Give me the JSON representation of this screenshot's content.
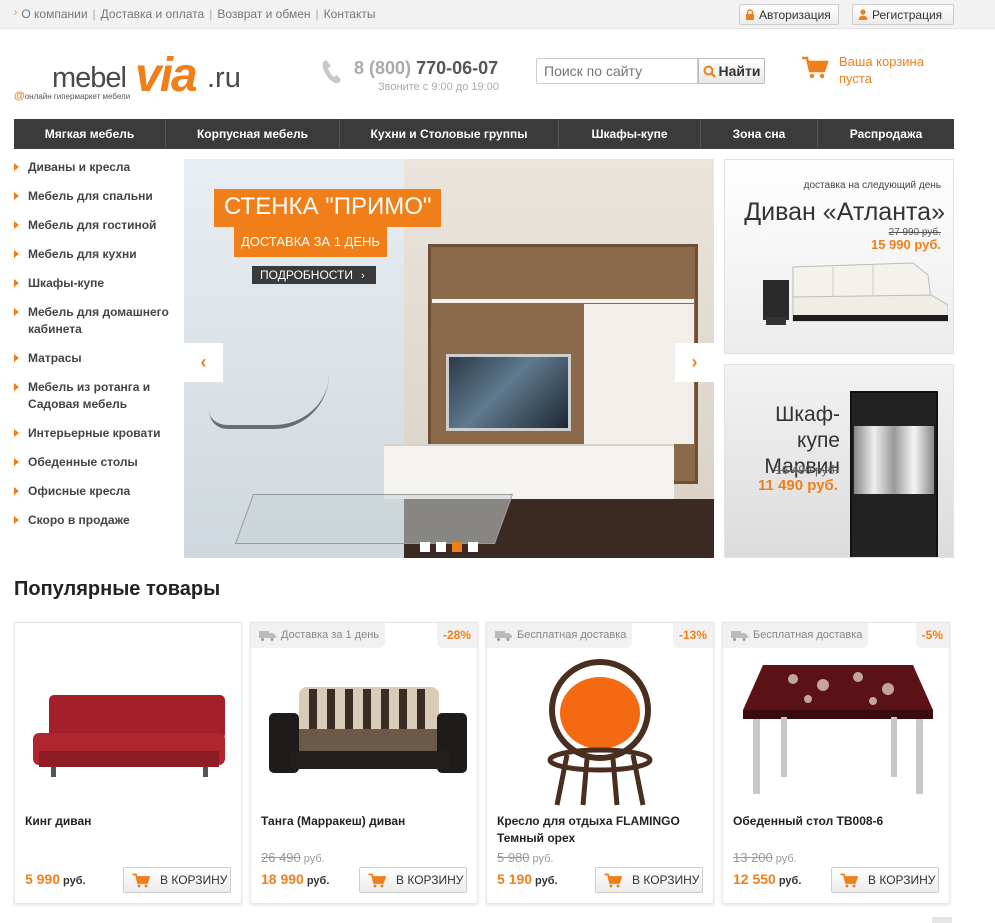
{
  "topbar": {
    "links": [
      "О компании",
      "Доставка и оплата",
      "Возврат и обмен",
      "Контакты"
    ],
    "auth_label": "Авторизация",
    "register_label": "Регистрация"
  },
  "logo": {
    "mebel": "mebel",
    "via": "via",
    "ru": ".ru",
    "tagline": "онлайн гипермаркет мебели"
  },
  "contact": {
    "phone_prefix": "8 (800)",
    "phone_number": "770-06-07",
    "hours": "Звоните с 9:00 до 19:00"
  },
  "search": {
    "placeholder": "Поиск по сайту",
    "button": "Найти"
  },
  "cart": {
    "text": "Ваша корзина пуста"
  },
  "nav": [
    "Мягкая мебель",
    "Корпусная мебель",
    "Кухни и Столовые группы",
    "Шкафы-купе",
    "Зона сна",
    "Распродажа"
  ],
  "sidebar": [
    "Диваны и кресла",
    "Мебель для спальни",
    "Мебель для гостиной",
    "Мебель для кухни",
    "Шкафы-купе",
    "Мебель для домашнего кабинета",
    "Матрасы",
    "Мебель из ротанга и Садовая мебель",
    "Интерьерные кровати",
    "Обеденные столы",
    "Офисные кресла",
    "Скоро в продаже"
  ],
  "slider": {
    "title": "СТЕНКА \"ПРИМО\"",
    "subtitle": "ДОСТАВКА ЗА 1 ДЕНЬ",
    "more": "ПОДРОБНОСТИ",
    "prev_icon": "chevron-left-icon",
    "next_icon": "chevron-right-icon",
    "slide_count": 4,
    "active_slide": 3
  },
  "promo1": {
    "note": "доставка на следующий день",
    "title": "Диван «Атланта»",
    "old_price": "27 990 руб.",
    "new_price": "15 990 руб."
  },
  "promo2": {
    "title": "Шкаф-купе Марвин",
    "old_price": "16 490 руб.",
    "new_price": "11 490 руб."
  },
  "popular": {
    "title": "Популярные товары",
    "currency": "руб.",
    "buy_label": "В КОРЗИНУ",
    "items": [
      {
        "ship": "",
        "discount": "",
        "name": "Кинг диван",
        "old_price": "",
        "price": "5 990"
      },
      {
        "ship": "Доставка за 1 день",
        "discount": "-28%",
        "name": "Танга (Марракеш) диван",
        "old_price": "26 490",
        "price": "18 990"
      },
      {
        "ship": "Бесплатная доставка",
        "discount": "-13%",
        "name": "Кресло для отдыха FLAMINGO Темный орех",
        "old_price": "5 980",
        "price": "5 190"
      },
      {
        "ship": "Бесплатная доставка",
        "discount": "-5%",
        "name": "Обеденный стол TB008-6",
        "old_price": "13 200",
        "price": "12 550"
      }
    ]
  },
  "colors": {
    "accent": "#f07f1a",
    "nav_bg": "#3b3b3b",
    "text": "#333333"
  }
}
